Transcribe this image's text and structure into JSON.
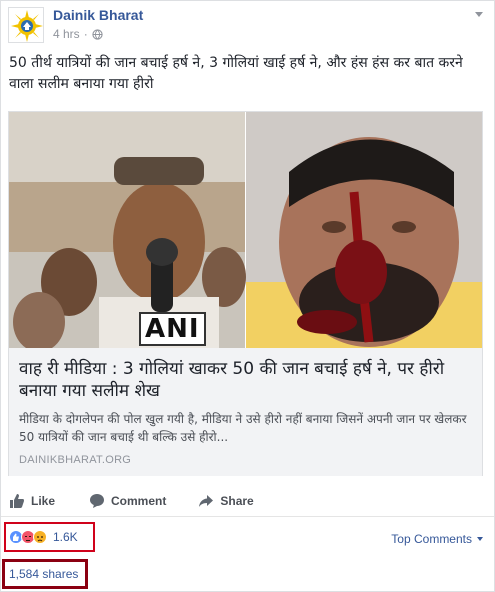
{
  "post": {
    "page_name": "Dainik Bharat",
    "time": "4 hrs",
    "separator": "·",
    "text": "50 तीर्थ यात्रियों की जान बचाई हर्ष ने, 3 गोलियां खाई हर्ष ने, और हंस हंस कर बात करने वाला सलीम बनाया गया हीरो"
  },
  "link": {
    "image_badge": "ANI",
    "title": "वाह री मीडिया : 3 गोलियां खाकर 50 की जान बचाई हर्ष ने, पर हीरो बनाया गया सलीम शेख",
    "description": "मीडिया के दोगलेपन की पोल खुल गयी है, मीडिया ने उसे हीरो नहीं बनाया जिसनें अपनी जान पर खेलकर 50 यात्रियों की जान बचाई थी बल्कि उसे हीरो...",
    "domain": "DAINIKBHARAT.ORG"
  },
  "actions": {
    "like": "Like",
    "comment": "Comment",
    "share": "Share"
  },
  "reactions": {
    "count": "1.6K",
    "icons": [
      "like-icon",
      "angry-icon",
      "sad-icon"
    ],
    "colors": {
      "like": "#5890ff",
      "angry": "#f25268",
      "sad": "#f7b125"
    }
  },
  "comments_filter": {
    "label": "Top Comments"
  },
  "shares": {
    "label": "1,584 shares"
  },
  "colors": {
    "link_blue": "#365899",
    "highlight_red": "#d0021b",
    "highlight_dark": "#8b0011"
  }
}
